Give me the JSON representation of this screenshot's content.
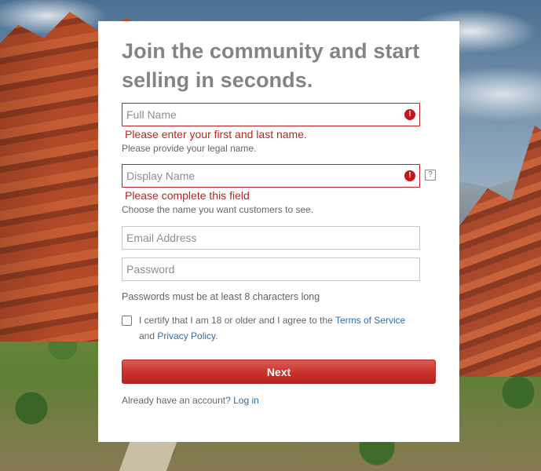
{
  "form": {
    "title_line1": "Join the community and start",
    "title_line2": "selling in seconds.",
    "full_name": {
      "placeholder": "Full Name",
      "error": "Please enter your first and last name.",
      "hint": "Please provide your legal name."
    },
    "display_name": {
      "placeholder": "Display Name",
      "error": "Please complete this field",
      "hint": "Choose the name you want customers to see.",
      "help_glyph": "?"
    },
    "email": {
      "placeholder": "Email Address"
    },
    "password": {
      "placeholder": "Password",
      "note": "Passwords must be at least 8 characters long"
    },
    "certify": {
      "prefix": "I certify that I am 18 or older and I agree to the",
      "tos_link": "Terms of Service",
      "and": "and",
      "privacy_link": "Privacy Policy",
      "suffix": "."
    },
    "next_label": "Next",
    "login_prompt": "Already have an account?",
    "login_link": "Log in",
    "error_glyph": "!"
  },
  "colors": {
    "error": "#b8261f",
    "link": "#2f6ea3",
    "button": "#c8302b",
    "title": "#848484"
  },
  "icons": [
    "error-icon",
    "help-icon"
  ]
}
